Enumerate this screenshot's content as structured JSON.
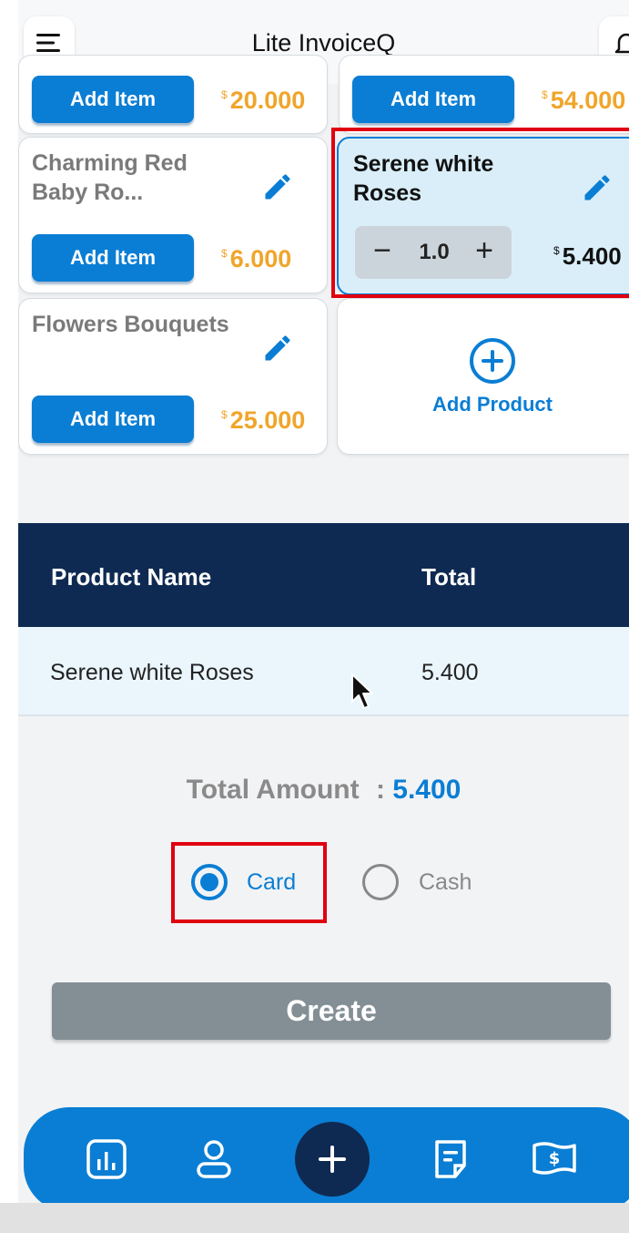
{
  "app": {
    "title": "Lite InvoiceQ"
  },
  "products": [
    {
      "name": "",
      "button": "Add Item",
      "currency": "$",
      "price": "20.000"
    },
    {
      "name": "",
      "button": "Add Item",
      "currency": "$",
      "price": "54.000"
    },
    {
      "name": "Charming Red Baby Ro...",
      "button": "Add Item",
      "currency": "$",
      "price": "6.000"
    },
    {
      "name": "Serene white Roses",
      "quantity": "1.0",
      "currency": "$",
      "price": "5.400",
      "selected": true
    },
    {
      "name": "Flowers Bouquets",
      "button": "Add Item",
      "currency": "$",
      "price": "25.000"
    }
  ],
  "add_product": {
    "label": "Add Product"
  },
  "table": {
    "headers": [
      "Product Name",
      "Total"
    ],
    "rows": [
      {
        "name": "Serene white Roses",
        "total": "5.400"
      }
    ]
  },
  "summary": {
    "label": "Total Amount",
    "separator": ":",
    "value": "5.400"
  },
  "payment": {
    "selected": "Card",
    "options": [
      {
        "label": "Card",
        "checked": true
      },
      {
        "label": "Cash",
        "checked": false
      }
    ]
  },
  "create_button": {
    "label": "Create"
  },
  "bottom_nav": {
    "items": [
      "chart-icon",
      "person-icon",
      "plus-icon",
      "note-icon",
      "money-icon"
    ]
  },
  "colors": {
    "primary": "#0a7ed4",
    "navy": "#0f2a52",
    "price": "#f0a52a",
    "highlight": "#e00010",
    "disabled": "#838e95"
  }
}
